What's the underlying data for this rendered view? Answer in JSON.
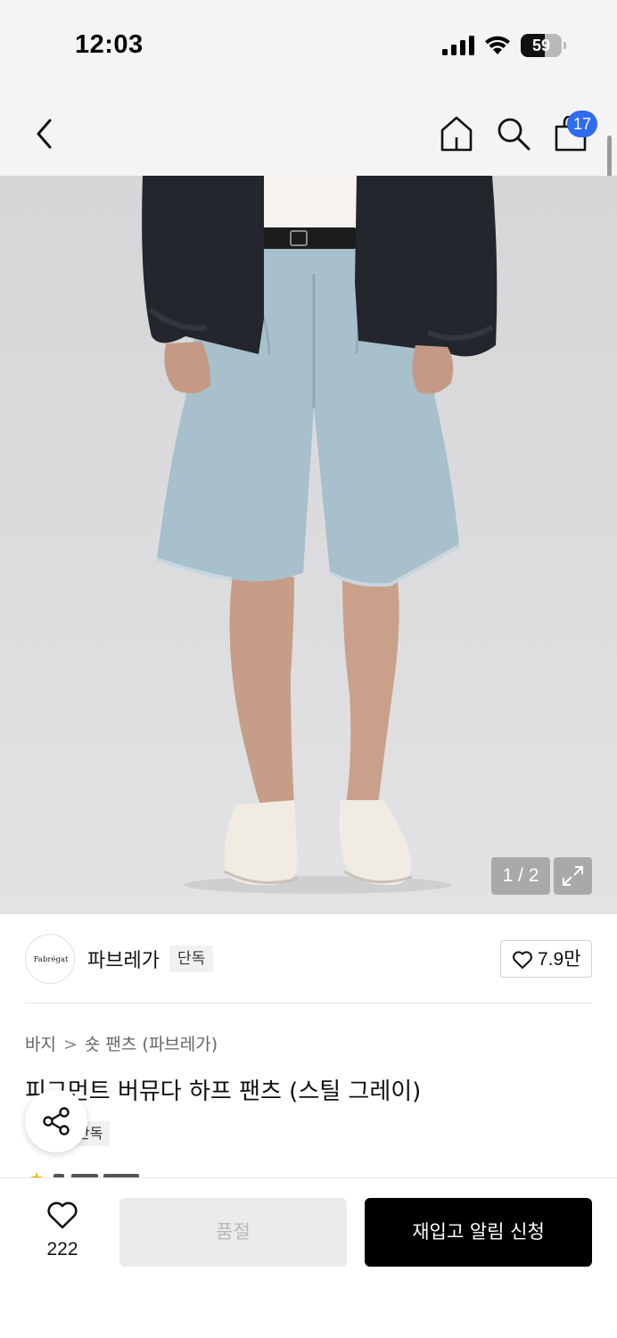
{
  "status_bar": {
    "time": "12:03",
    "battery_level": "59",
    "battery_fraction": 0.59
  },
  "header": {
    "cart_count": "17",
    "icons": [
      "back-arrow-icon",
      "home-icon",
      "search-icon",
      "shopping-bag-icon"
    ],
    "badge_color": "#2f6bf0"
  },
  "gallery": {
    "counter": "1 / 2",
    "expand_icon": "expand-icon"
  },
  "brand": {
    "logo_text": "Fabrégat",
    "name": "파브레가",
    "badge": "단독",
    "like_count": "7.9만"
  },
  "product": {
    "breadcrumb": [
      "바지",
      "숏 팬츠 (파브레가)"
    ],
    "title": "피그먼트 버뮤다 하프 팬츠 (스틸 그레이)",
    "badge": "단독"
  },
  "bottom_bar": {
    "wish_count": "222",
    "soldout_label": "품절",
    "restock_label": "재입고 알림 신청"
  },
  "colors": {
    "primary_button": "#000000",
    "disabled_button": "#ebebeb",
    "header_bg": "#f4f4f4"
  }
}
